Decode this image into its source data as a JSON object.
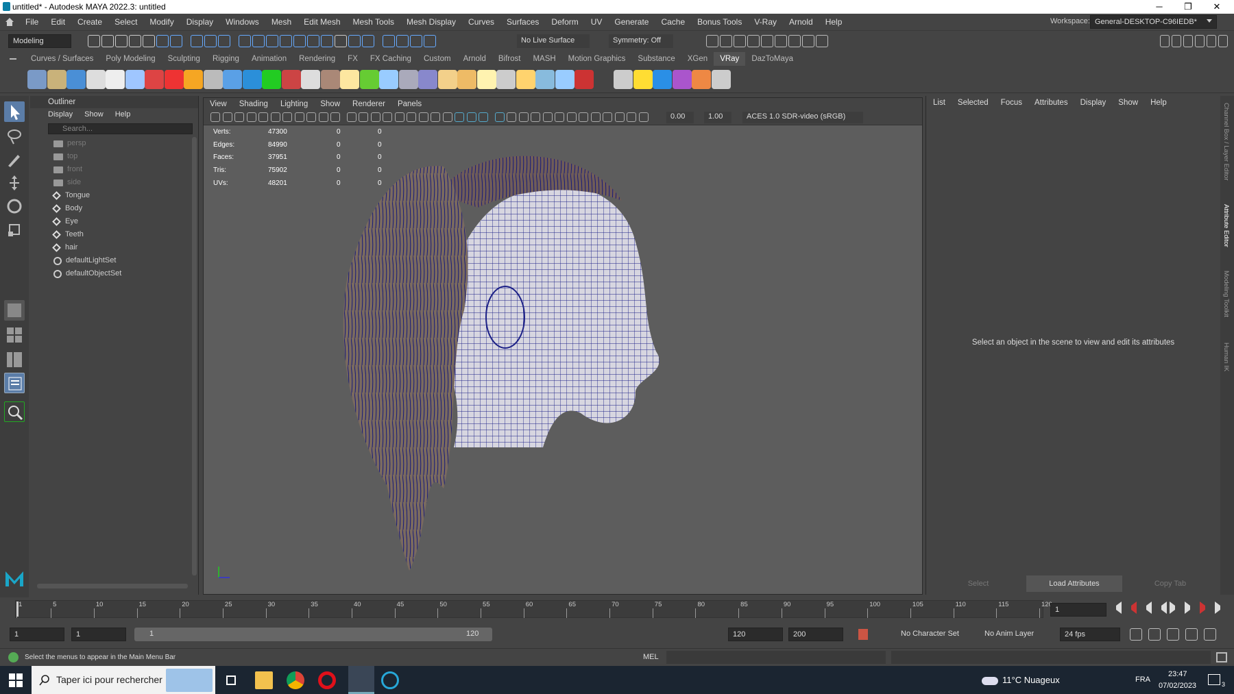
{
  "window": {
    "title": "untitled* - Autodesk MAYA 2022.3: untitled",
    "minimize": "─",
    "restore": "❐",
    "close": "✕"
  },
  "menubar": {
    "items": [
      "File",
      "Edit",
      "Create",
      "Select",
      "Modify",
      "Display",
      "Windows",
      "Mesh",
      "Edit Mesh",
      "Mesh Tools",
      "Mesh Display",
      "Curves",
      "Surfaces",
      "Deform",
      "UV",
      "Generate",
      "Cache",
      "Bonus Tools",
      "V-Ray",
      "Arnold",
      "Help"
    ],
    "workspace_label": "Workspace:",
    "workspace_value": "General-DESKTOP-C96IEDB*"
  },
  "statusline": {
    "mode": "Modeling",
    "live_surface": "No Live Surface",
    "symmetry": "Symmetry: Off"
  },
  "shelf": {
    "tabs": [
      "Curves / Surfaces",
      "Poly Modeling",
      "Sculpting",
      "Rigging",
      "Animation",
      "Rendering",
      "FX",
      "FX Caching",
      "Custom",
      "Arnold",
      "Bifrost",
      "MASH",
      "Motion Graphics",
      "Substance",
      "XGen",
      "VRay",
      "DazToMaya"
    ],
    "active_tab": "VRay"
  },
  "outliner": {
    "title": "Outliner",
    "menus": [
      "Display",
      "Show",
      "Help"
    ],
    "search_placeholder": "Search...",
    "items": [
      {
        "name": "persp",
        "type": "camera"
      },
      {
        "name": "top",
        "type": "camera"
      },
      {
        "name": "front",
        "type": "camera"
      },
      {
        "name": "side",
        "type": "camera"
      },
      {
        "name": "Tongue",
        "type": "mesh"
      },
      {
        "name": "Body",
        "type": "mesh"
      },
      {
        "name": "Eye",
        "type": "mesh"
      },
      {
        "name": "Teeth",
        "type": "mesh"
      },
      {
        "name": "hair",
        "type": "mesh"
      },
      {
        "name": "defaultLightSet",
        "type": "set"
      },
      {
        "name": "defaultObjectSet",
        "type": "set"
      }
    ]
  },
  "viewport": {
    "menus": [
      "View",
      "Shading",
      "Lighting",
      "Show",
      "Renderer",
      "Panels"
    ],
    "exposure": "0.00",
    "gamma": "1.00",
    "color_space": "ACES 1.0 SDR-video (sRGB)",
    "hud": [
      {
        "label": "Verts:",
        "value": "47300",
        "sel": "0",
        "comp": "0"
      },
      {
        "label": "Edges:",
        "value": "84990",
        "sel": "0",
        "comp": "0"
      },
      {
        "label": "Faces:",
        "value": "37951",
        "sel": "0",
        "comp": "0"
      },
      {
        "label": "Tris:",
        "value": "75902",
        "sel": "0",
        "comp": "0"
      },
      {
        "label": "UVs:",
        "value": "48201",
        "sel": "0",
        "comp": "0"
      }
    ]
  },
  "attribute_editor": {
    "menus": [
      "List",
      "Selected",
      "Focus",
      "Attributes",
      "Display",
      "Show",
      "Help"
    ],
    "message": "Select an object in the scene to view and edit its attributes",
    "buttons": [
      "Select",
      "Load Attributes",
      "Copy Tab"
    ]
  },
  "side_tabs": [
    "Channel Box / Layer Editor",
    "Attribute Editor",
    "Modeling Toolkit",
    "Human IK"
  ],
  "timeline": {
    "ticks": [
      "1",
      "5",
      "10",
      "15",
      "20",
      "25",
      "30",
      "35",
      "40",
      "45",
      "50",
      "55",
      "60",
      "65",
      "70",
      "75",
      "80",
      "85",
      "90",
      "95",
      "100",
      "105",
      "110",
      "115",
      "120"
    ],
    "current_frame": "1"
  },
  "range": {
    "start": "1",
    "anim_start": "1",
    "range_start": "1",
    "range_end": "120",
    "end": "120",
    "anim_end": "200",
    "character_set": "No Character Set",
    "anim_layer": "No Anim Layer",
    "fps": "24 fps"
  },
  "commandline": {
    "help": "Select the menus to appear in the Main Menu Bar",
    "lang": "MEL"
  },
  "taskbar": {
    "search": "Taper ici pour rechercher",
    "weather": "11°C  Nuageux",
    "lang": "FRA",
    "time": "23:47",
    "date": "07/02/2023",
    "notif": "3"
  }
}
